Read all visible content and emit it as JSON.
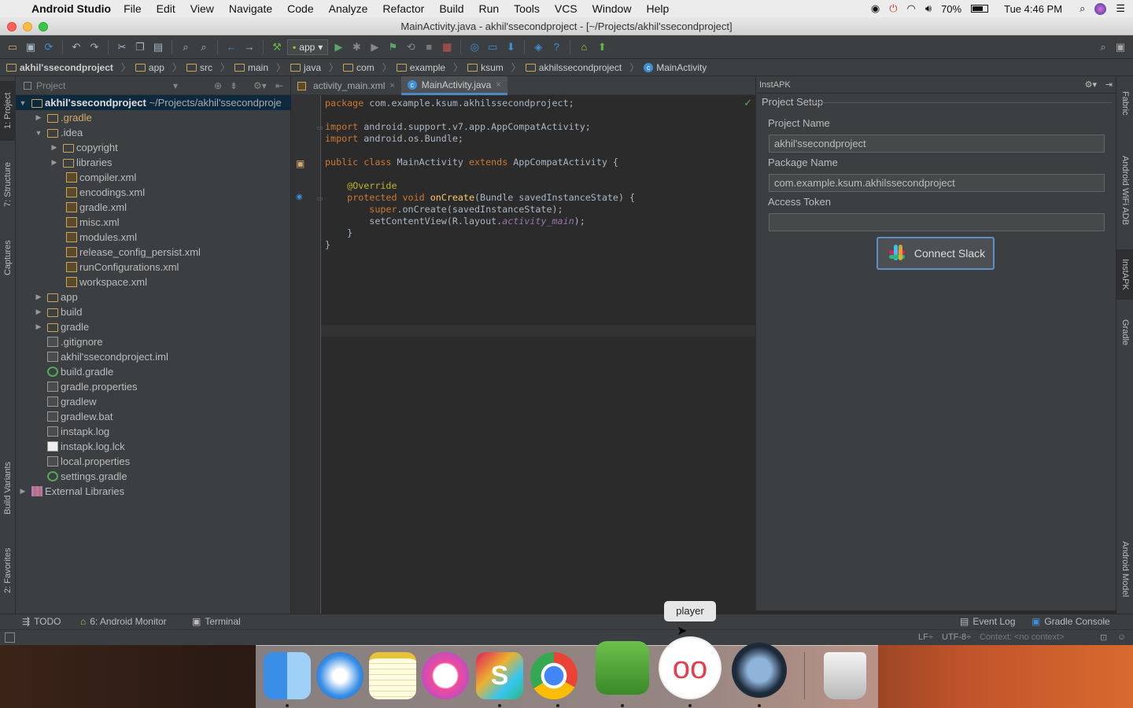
{
  "menubar": {
    "app": "Android Studio",
    "items": [
      "File",
      "Edit",
      "View",
      "Navigate",
      "Code",
      "Analyze",
      "Refactor",
      "Build",
      "Run",
      "Tools",
      "VCS",
      "Window",
      "Help"
    ],
    "battery": "70%",
    "clock": "Tue 4:46 PM"
  },
  "window": {
    "title": "MainActivity.java - akhil'ssecondproject - [~/Projects/akhil'ssecondproject]"
  },
  "toolbar": {
    "run_config": "app"
  },
  "breadcrumbs": [
    "akhil'ssecondproject",
    "app",
    "src",
    "main",
    "java",
    "com",
    "example",
    "ksum",
    "akhilssecondproject",
    "MainActivity"
  ],
  "project_panel": {
    "title": "Project",
    "root": "akhil'ssecondproject",
    "root_path": "~/Projects/akhil'ssecondproje",
    "items": [
      ".gradle",
      ".idea",
      "copyright",
      "libraries",
      "compiler.xml",
      "encodings.xml",
      "gradle.xml",
      "misc.xml",
      "modules.xml",
      "release_config_persist.xml",
      "runConfigurations.xml",
      "workspace.xml",
      "app",
      "build",
      "gradle",
      ".gitignore",
      "akhil'ssecondproject.iml",
      "build.gradle",
      "gradle.properties",
      "gradlew",
      "gradlew.bat",
      "instapk.log",
      "instapk.log.lck",
      "local.properties",
      "settings.gradle",
      "External Libraries"
    ]
  },
  "editor": {
    "tabs": [
      "activity_main.xml",
      "MainActivity.java"
    ],
    "code": {
      "l1k": "package",
      "l1": " com.example.ksum.akhilssecondproject;",
      "l3k": "import",
      "l3": " android.support.v7.app.AppCompatActivity;",
      "l4k": "import",
      "l4": " android.os.Bundle;",
      "l6a": "public class",
      "l6b": " MainActivity ",
      "l6c": "extends",
      "l6d": " AppCompatActivity {",
      "l8": "@Override",
      "l9a": "protected void",
      "l9b": " onCreate",
      "l9c": "(Bundle savedInstanceState) {",
      "l10a": "super",
      "l10b": ".onCreate(savedInstanceState);",
      "l11a": "setContentView(R.layout.",
      "l11b": "activity_main",
      "l11c": ");",
      "l12": "}",
      "l13": "}"
    }
  },
  "instapk": {
    "title": "InstAPK",
    "section": "Project Setup",
    "project_name_label": "Project Name",
    "project_name": "akhil'ssecondproject",
    "package_name_label": "Package Name",
    "package_name": "com.example.ksum.akhilssecondproject",
    "token_label": "Access Token",
    "token": "",
    "connect_label": "Connect Slack"
  },
  "left_tabs": [
    "1: Project",
    "7: Structure",
    "Captures",
    "Build Variants",
    "2: Favorites"
  ],
  "right_tabs": [
    "Fabric",
    "Android WiFi ADB",
    "InstAPK",
    "Gradle",
    "Android Model"
  ],
  "bottom_tabs": {
    "todo": "TODO",
    "monitor": "6: Android Monitor",
    "terminal": "Terminal",
    "event_log": "Event Log",
    "gradle_console": "Gradle Console"
  },
  "status": {
    "lf": "LF÷",
    "enc": "UTF-8÷",
    "context": "Context: <no context>"
  },
  "dock_tooltip": "player"
}
